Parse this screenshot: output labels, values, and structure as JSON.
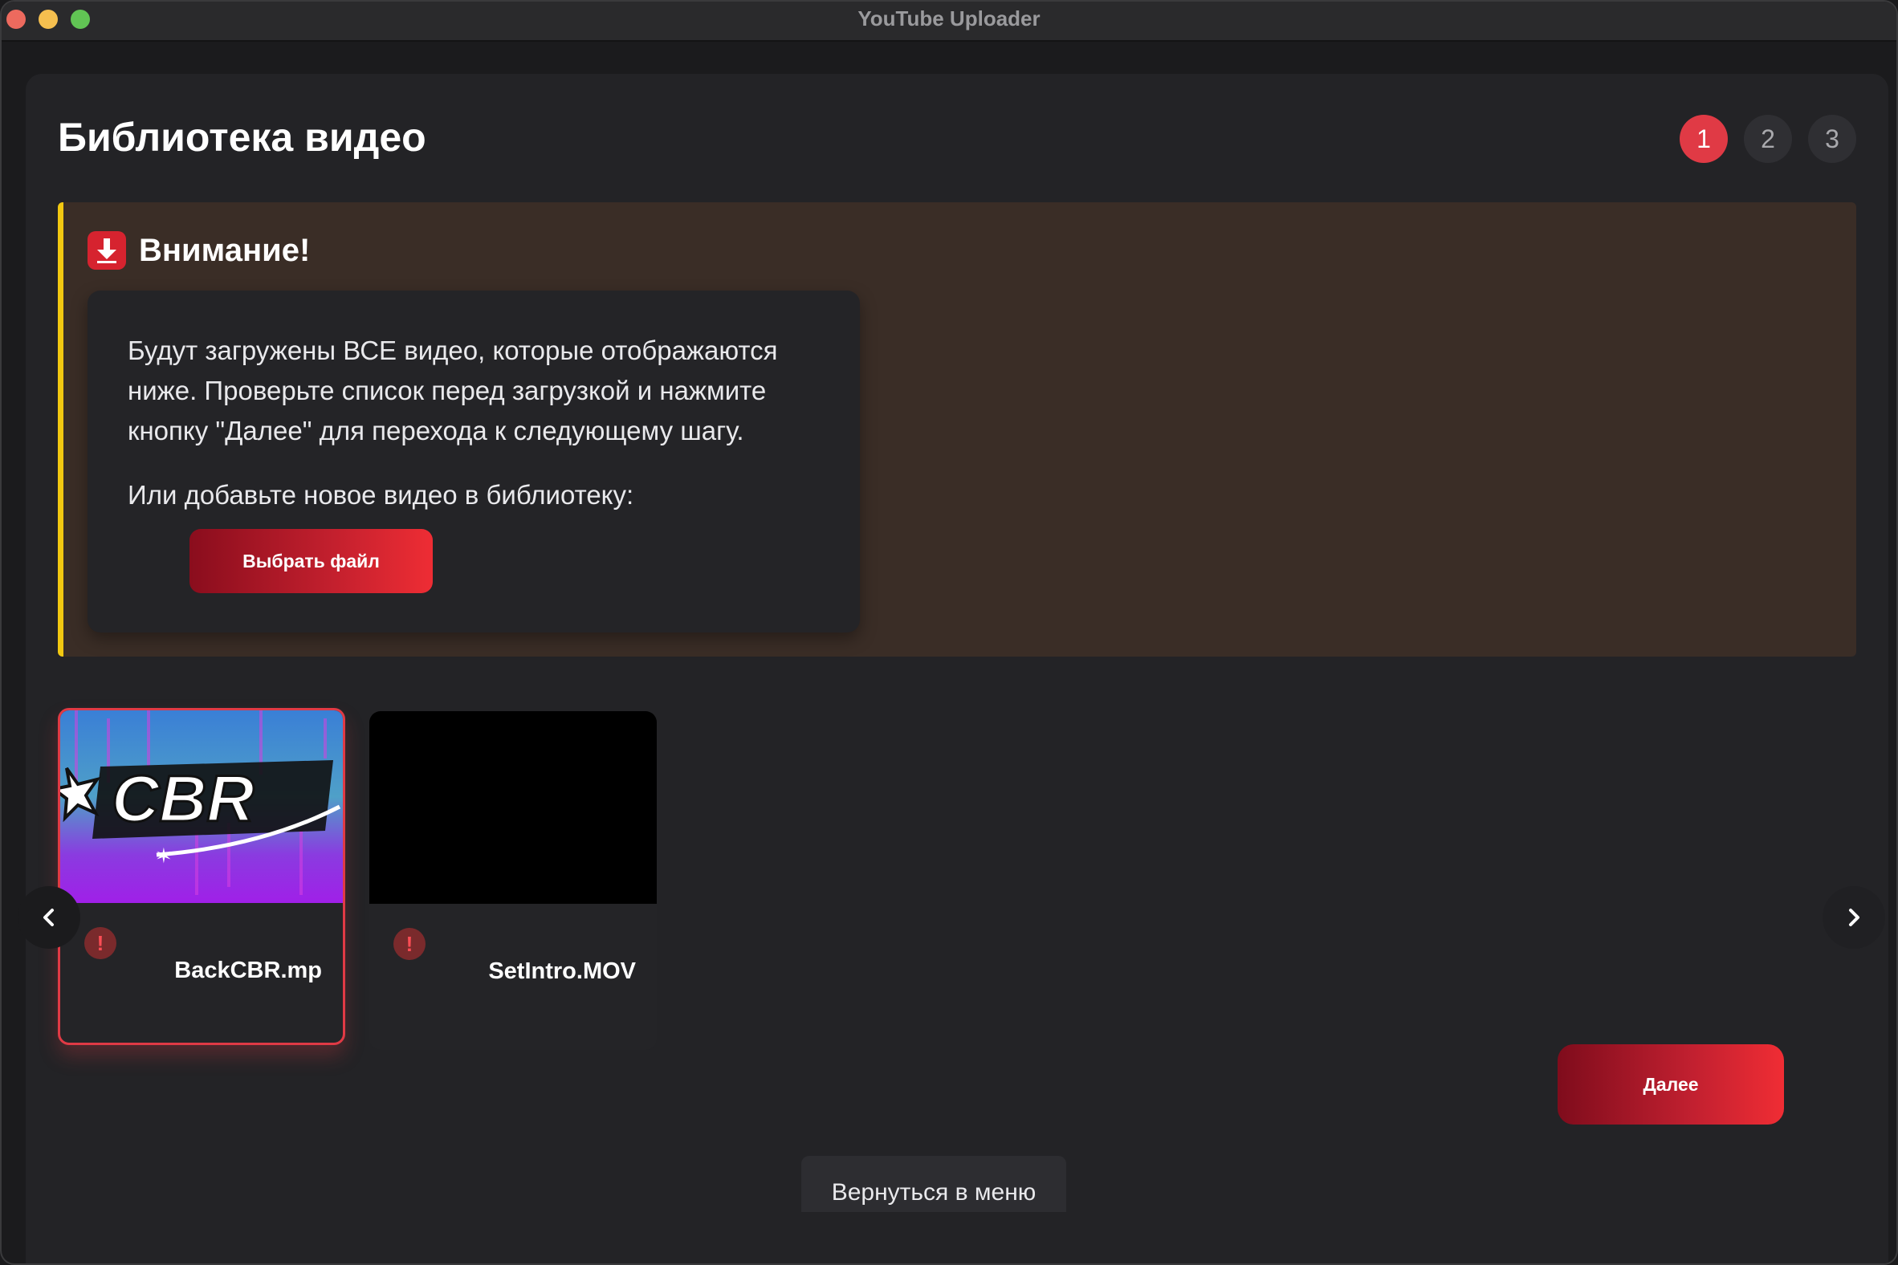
{
  "window": {
    "title": "YouTube Uploader"
  },
  "page": {
    "title": "Библиотека видео"
  },
  "steps": [
    {
      "label": "1",
      "active": true
    },
    {
      "label": "2",
      "active": false
    },
    {
      "label": "3",
      "active": false
    }
  ],
  "warning": {
    "title": "Внимание!",
    "icon": "download-arrow-icon",
    "text": "Будут загружены ВСЕ видео, которые отображаются ниже. Проверьте список перед загрузкой и нажмите кнопку \"Далее\" для перехода к следующему шагу.",
    "subtext": "Или добавьте новое видео в библиотеку:",
    "choose_file_label": "Выбрать файл"
  },
  "videos": [
    {
      "file_name": "BackCBR.mp",
      "thumbnail": "cbr-logo-thumbnail",
      "selected": true,
      "status_icon": "error-icon"
    },
    {
      "file_name": "SetIntro.MOV",
      "thumbnail": "black-thumbnail",
      "selected": false,
      "status_icon": "error-icon"
    }
  ],
  "carousel": {
    "prev_icon": "chevron-left-icon",
    "next_icon": "chevron-right-icon"
  },
  "actions": {
    "next_label": "Далее",
    "back_to_menu_label": "Вернуться в меню"
  },
  "colors": {
    "accent": "#e03a45",
    "warning_border": "#f2c811",
    "warning_bg": "#3a2d26",
    "panel_bg": "#232326"
  }
}
